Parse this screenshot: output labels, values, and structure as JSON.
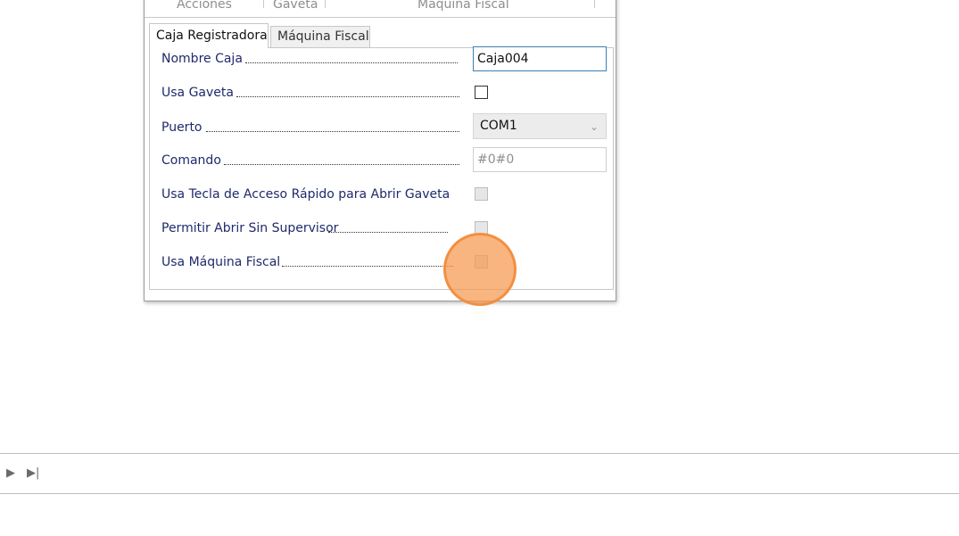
{
  "ribbon": {
    "groups": [
      "Acciones",
      "Gaveta",
      "Máquina Fiscal"
    ]
  },
  "tabs": [
    {
      "label": "Caja Registradora",
      "active": true
    },
    {
      "label": "Máquina Fiscal",
      "active": false
    }
  ],
  "form": {
    "nombre_caja": {
      "label": "Nombre Caja",
      "value": "Caja004"
    },
    "usa_gaveta": {
      "label": "Usa Gaveta",
      "checked": false
    },
    "puerto": {
      "label": "Puerto",
      "value": "COM1"
    },
    "comando": {
      "label": "Comando",
      "value": "#0#0"
    },
    "usa_tecla": {
      "label": "Usa Tecla de Acceso Rápido para Abrir Gaveta",
      "checked": false
    },
    "permitir_abrir": {
      "label": "Permitir Abrir Sin Supervisor",
      "checked": false
    },
    "usa_maquina_fiscal": {
      "label": "Usa Máquina Fiscal",
      "checked": false
    }
  },
  "navigator": {
    "next_icon": "play-next-icon",
    "last_icon": "skip-last-icon"
  },
  "colors": {
    "label": "#1f2a6b",
    "focus_border": "#3c7fb1",
    "click_highlight": "#f6984d"
  }
}
